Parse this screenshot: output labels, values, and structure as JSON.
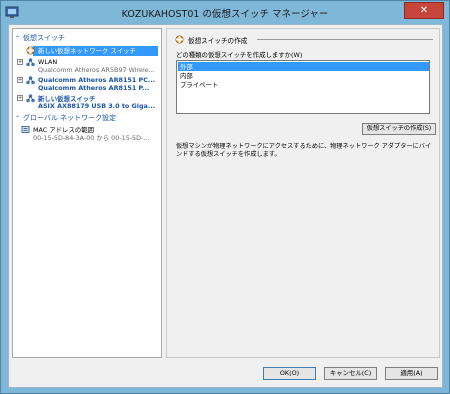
{
  "window": {
    "title": "KOZUKAHOST01 の仮想スイッチ マネージャー",
    "close_label": "✕"
  },
  "tree": {
    "virtual_switches_header": "仮想スイッチ",
    "new_switch": "新しい仮想ネットワーク スイッチ",
    "switches": [
      {
        "name": "WLAN",
        "adapter": "Qualcomm Atheros AR5B97 Wirele..."
      },
      {
        "name": "Qualcomm Atheros AR8151 PC...",
        "adapter": "Qualcomm Atheros AR8151 P..."
      },
      {
        "name": "新しい仮想スイッチ",
        "adapter": "ASIX AX88179 USB 3.0 to Giga..."
      }
    ],
    "global_header": "グローバル ネットワーク設定",
    "mac_range": {
      "name": "MAC アドレスの範囲",
      "value": "00-15-5D-84-3A-00 から 00-15-5D-..."
    }
  },
  "content": {
    "heading": "仮想スイッチの作成",
    "prompt": "どの種類の仮想スイッチを作成しますか(W)",
    "types": [
      "外部",
      "内部",
      "プライベート"
    ],
    "selected_type": 0,
    "create_button": "仮想スイッチの作成(S)",
    "description": "仮想マシンが物理ネットワークにアクセスするために、物理ネットワーク アダプターにバインドする仮想スイッチを作成します。"
  },
  "footer": {
    "ok": "OK(O)",
    "cancel": "キャンセル(C)",
    "apply": "適用(A)"
  },
  "colors": {
    "accent": "#1c55a8",
    "selection": "#3399ff",
    "titlebar": "#7fb7d8"
  }
}
